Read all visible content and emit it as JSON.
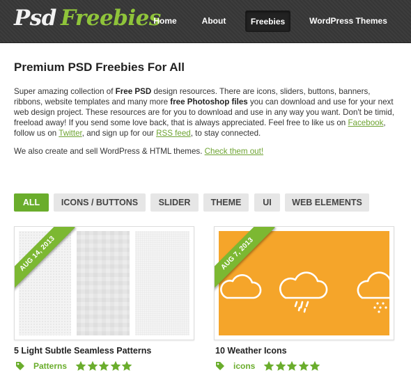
{
  "logo": {
    "part1": "Psd",
    "part2": "Freebies"
  },
  "nav": [
    {
      "label": "Home"
    },
    {
      "label": "About"
    },
    {
      "label": "Freebies"
    },
    {
      "label": "WordPress Themes"
    }
  ],
  "main": {
    "title": "Premium PSD Freebies For All",
    "intro": {
      "t1": "Super amazing collection of ",
      "b1": "Free PSD",
      "t2": " design resources. There are icons, sliders, buttons, banners, ribbons, website templates and many more ",
      "b2": "free Photoshop files",
      "t3": " you can download and use for your next web design project. These resources are for you to download and use in any way you want. Don't be timid, freeload away! If you send some love back, that is always appreciated. Feel free to like us on ",
      "link_facebook": "Facebook",
      "t4": ", follow us on ",
      "link_twitter": "Twitter",
      "t5": ", and sign up for our ",
      "link_rss": "RSS feed",
      "t6": ", to stay connected."
    },
    "also": {
      "text": "We also create and sell WordPress & HTML themes. ",
      "link": "Check them out!"
    }
  },
  "filters": [
    {
      "label": "ALL"
    },
    {
      "label": "ICONS / BUTTONS"
    },
    {
      "label": "SLIDER"
    },
    {
      "label": "THEME"
    },
    {
      "label": "UI"
    },
    {
      "label": "WEB ELEMENTS"
    }
  ],
  "items": [
    {
      "date": "AUG 14, 2013",
      "title": "5 Light Subtle Seamless Patterns",
      "category": "Patterns",
      "rating": 5
    },
    {
      "date": "AUG 7, 2013",
      "title": "10 Weather Icons",
      "category": "icons",
      "rating": 5
    }
  ],
  "colors": {
    "accent": "#6aad2c",
    "header_bg": "#383838",
    "weather_bg": "#f5a52a"
  },
  "icons": {
    "tag": "tag-icon",
    "star": "star-icon",
    "cloud": "cloud-icon"
  }
}
